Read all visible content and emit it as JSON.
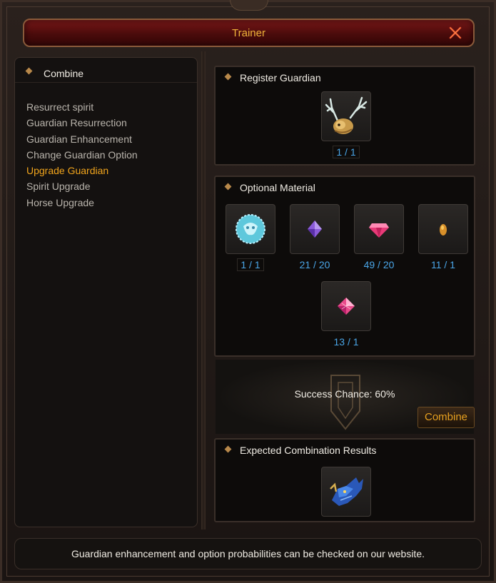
{
  "window": {
    "title": "Trainer"
  },
  "sidebar": {
    "header": "Combine",
    "items": [
      {
        "label": "Resurrect spirit",
        "active": false
      },
      {
        "label": "Guardian Resurrection",
        "active": false
      },
      {
        "label": "Guardian Enhancement",
        "active": false
      },
      {
        "label": "Change Guardian Option",
        "active": false
      },
      {
        "label": "Upgrade Guardian",
        "active": true
      },
      {
        "label": "Spirit Upgrade",
        "active": false
      },
      {
        "label": "Horse Upgrade",
        "active": false
      }
    ]
  },
  "register": {
    "header": "Register Guardian",
    "item": {
      "icon": "antler-guardian-icon",
      "count": "1 / 1"
    }
  },
  "optional": {
    "header": "Optional Material",
    "items": [
      {
        "icon": "blue-orb-icon",
        "count": "1 / 1"
      },
      {
        "icon": "purple-gem-icon",
        "count": "21 / 20"
      },
      {
        "icon": "pink-gem-icon",
        "count": "49 / 20"
      },
      {
        "icon": "amber-seed-icon",
        "count": "11 / 1"
      },
      {
        "icon": "pink-crystal-icon",
        "count": "13 / 1"
      }
    ]
  },
  "success": {
    "text": "Success Chance: 60%",
    "combine_label": "Combine"
  },
  "results": {
    "header": "Expected Combination Results",
    "item": {
      "icon": "blue-dragon-guardian-icon"
    }
  },
  "footer": {
    "text": "Guardian enhancement and option probabilities can be checked on our website."
  },
  "colors": {
    "accent": "#f2a51c",
    "count": "#4aa6e8",
    "title_bar": "#6a1212"
  }
}
